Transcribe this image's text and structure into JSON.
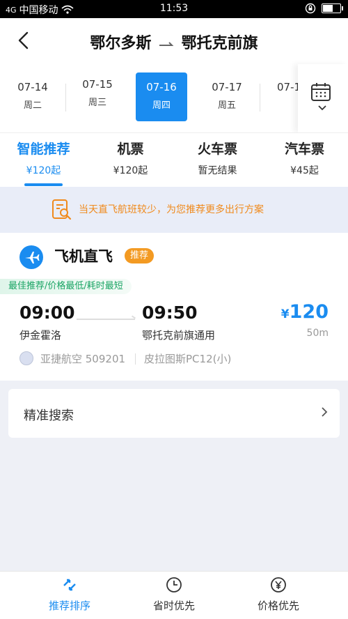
{
  "status_bar": {
    "carrier": "中国移动",
    "signal": "4G",
    "time": "11:53"
  },
  "header": {
    "from": "鄂尔多斯",
    "to": "鄂托克前旗"
  },
  "dates": [
    {
      "date": "07-14",
      "weekday": "周二"
    },
    {
      "date": "07-15",
      "weekday": "周三"
    },
    {
      "date": "07-16",
      "weekday": "周四",
      "active": true
    },
    {
      "date": "07-17",
      "weekday": "周五"
    },
    {
      "date": "07-1",
      "weekday": ""
    }
  ],
  "tabs": [
    {
      "label": "智能推荐",
      "price": "¥120起",
      "active": true
    },
    {
      "label": "机票",
      "price": "¥120起"
    },
    {
      "label": "火车票",
      "price": "暂无结果"
    },
    {
      "label": "汽车票",
      "price": "¥45起"
    }
  ],
  "notice": {
    "text": "当天直飞航班较少，为您推荐更多出行方案"
  },
  "direct": {
    "label": "飞机直飞",
    "badge": "推荐",
    "best_tag": "最佳推荐/价格最低/耗时最短",
    "flight": {
      "dep_time": "09:00",
      "arr_time": "09:50",
      "dep_airport": "伊金霍洛",
      "arr_airport": "鄂托克前旗通用",
      "currency": "¥",
      "price": "120",
      "duration": "50m",
      "airline": "亚捷航空 509201",
      "aircraft": "皮拉图斯PC12(小)"
    }
  },
  "precise_search": {
    "label": "精准搜索"
  },
  "bottom_nav": [
    {
      "label": "推荐排序",
      "icon": "sort-icon",
      "active": true
    },
    {
      "label": "省时优先",
      "icon": "clock-icon"
    },
    {
      "label": "价格优先",
      "icon": "yen-icon"
    }
  ],
  "colors": {
    "accent": "#1a8cf0",
    "orange": "#f39a22",
    "green": "#19a463"
  }
}
